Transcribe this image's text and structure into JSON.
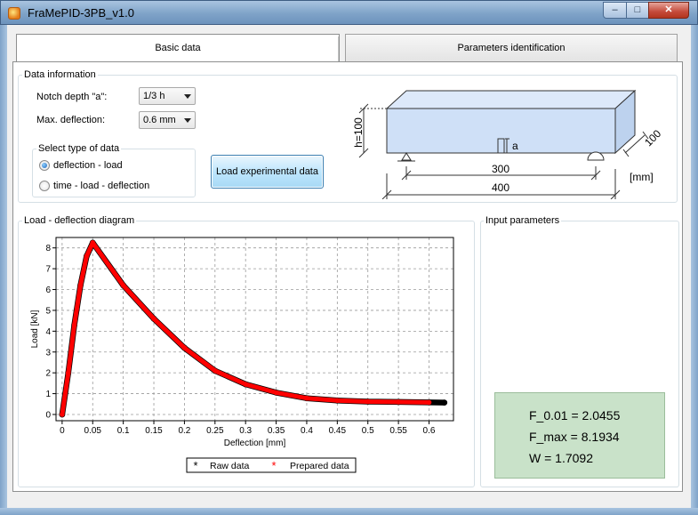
{
  "window": {
    "title": "FraMePID-3PB_v1.0",
    "min_glyph": "–",
    "max_glyph": "□",
    "close_glyph": "✕"
  },
  "tabs": [
    {
      "label": "Basic data",
      "active": true
    },
    {
      "label": "Parameters identification",
      "active": false
    }
  ],
  "data_info": {
    "group_label": "Data information",
    "notch_label": "Notch depth \"a\":",
    "notch_value": "1/3 h",
    "deflection_label": "Max. deflection:",
    "deflection_value": "0.6 mm",
    "select_group_label": "Select type of data",
    "radio_options": [
      {
        "label": "deflection - load",
        "checked": true
      },
      {
        "label": "time - load - deflection",
        "checked": false
      }
    ],
    "load_button": "Load experimental data"
  },
  "beam_diagram": {
    "height_label": "h=100",
    "notch_label": "a",
    "depth_label": "100",
    "span_label": "300",
    "length_label": "400",
    "unit_label": "[mm]"
  },
  "load_deflection": {
    "group_label": "Load - deflection diagram"
  },
  "input_params": {
    "group_label": "Input parameters",
    "lines": [
      "F_0.01 = 2.0455",
      "F_max = 8.1934",
      "W = 1.7092"
    ],
    "box_color": "#c9e2c9"
  },
  "chart_data": {
    "type": "scatter",
    "xlabel": "Deflection [mm]",
    "ylabel": "Load [kN]",
    "xlim": [
      -0.01,
      0.64
    ],
    "ylim": [
      -0.3,
      8.5
    ],
    "xticks": [
      "0",
      "0.05",
      "0.1",
      "0.15",
      "0.2",
      "0.25",
      "0.3",
      "0.35",
      "0.4",
      "0.45",
      "0.5",
      "0.55",
      "0.6"
    ],
    "yticks": [
      "0",
      "1",
      "2",
      "3",
      "4",
      "5",
      "6",
      "7",
      "8"
    ],
    "grid": true,
    "legend_position": "bottom",
    "series": [
      {
        "name": "Raw data",
        "color": "#000000",
        "marker": "star",
        "x": [
          0,
          0.01,
          0.02,
          0.03,
          0.04,
          0.05,
          0.1,
          0.15,
          0.2,
          0.25,
          0.3,
          0.35,
          0.4,
          0.45,
          0.5,
          0.55,
          0.6,
          0.625
        ],
        "y": [
          0,
          2.0,
          4.3,
          6.2,
          7.6,
          8.25,
          6.2,
          4.6,
          3.2,
          2.1,
          1.45,
          1.05,
          0.78,
          0.67,
          0.62,
          0.6,
          0.58,
          0.57
        ]
      },
      {
        "name": "Prepared data",
        "color": "#ff0000",
        "marker": "star",
        "x": [
          0,
          0.01,
          0.02,
          0.03,
          0.04,
          0.05,
          0.1,
          0.15,
          0.2,
          0.25,
          0.3,
          0.35,
          0.4,
          0.45,
          0.5,
          0.55,
          0.6
        ],
        "y": [
          0,
          2.0,
          4.3,
          6.2,
          7.6,
          8.25,
          6.2,
          4.6,
          3.2,
          2.1,
          1.45,
          1.05,
          0.78,
          0.67,
          0.62,
          0.6,
          0.58
        ]
      }
    ]
  }
}
